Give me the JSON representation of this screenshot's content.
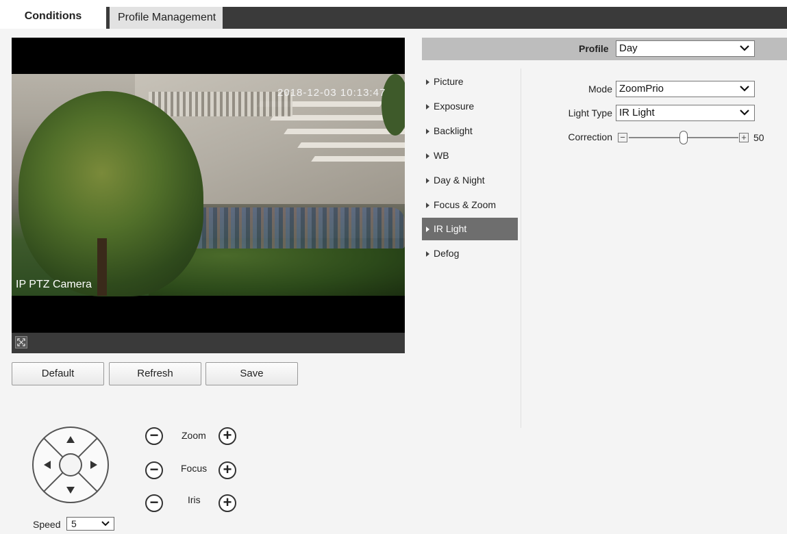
{
  "tabs": [
    {
      "label": "Conditions",
      "active": true
    },
    {
      "label": "Profile Management",
      "active": false
    }
  ],
  "video": {
    "osd_time": "2018-12-03 10:13:47",
    "osd_name": "IP PTZ Camera"
  },
  "buttons": {
    "default": "Default",
    "refresh": "Refresh",
    "save": "Save"
  },
  "ptz": {
    "zoom_label": "Zoom",
    "focus_label": "Focus",
    "iris_label": "Iris",
    "speed_label": "Speed",
    "speed_value": "5"
  },
  "profile": {
    "label": "Profile",
    "value": "Day"
  },
  "menu": [
    {
      "label": "Picture"
    },
    {
      "label": "Exposure"
    },
    {
      "label": "Backlight"
    },
    {
      "label": "WB"
    },
    {
      "label": "Day & Night"
    },
    {
      "label": "Focus & Zoom"
    },
    {
      "label": "IR Light",
      "active": true
    },
    {
      "label": "Defog"
    }
  ],
  "settings": {
    "mode_label": "Mode",
    "mode_value": "ZoomPrio",
    "light_type_label": "Light Type",
    "light_type_value": "IR Light",
    "correction_label": "Correction",
    "correction_value": "50",
    "correction_fraction": 0.5
  },
  "colors": {
    "tabbar": "#3a3a3a",
    "active_menu": "#6e6e6e",
    "profile_bar": "#bdbdbd"
  }
}
